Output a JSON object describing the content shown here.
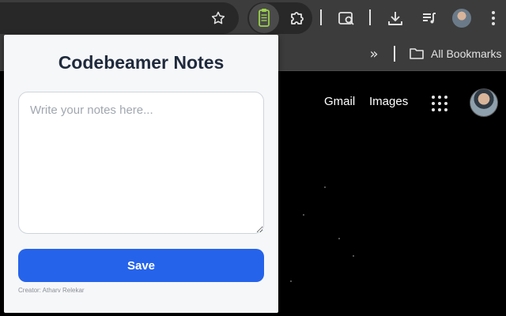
{
  "toolbar": {
    "icons": [
      "star-icon",
      "notes-extension-icon",
      "extensions-puzzle-icon",
      "lens-search-icon",
      "download-icon",
      "media-queue-icon",
      "profile-avatar",
      "more-menu-icon"
    ]
  },
  "bookmarks_bar": {
    "overflow_icon": "chevron-double-right-icon",
    "all_bookmarks_label": "All Bookmarks"
  },
  "google": {
    "gmail_label": "Gmail",
    "images_label": "Images",
    "apps_icon": "apps-grid-icon"
  },
  "popup": {
    "title": "Codebeamer Notes",
    "notes_placeholder": "Write your notes here...",
    "save_label": "Save",
    "creator_text": "Creator: Atharv Relekar",
    "accent_color": "#2563eb",
    "title_color": "#1f2a3c"
  }
}
